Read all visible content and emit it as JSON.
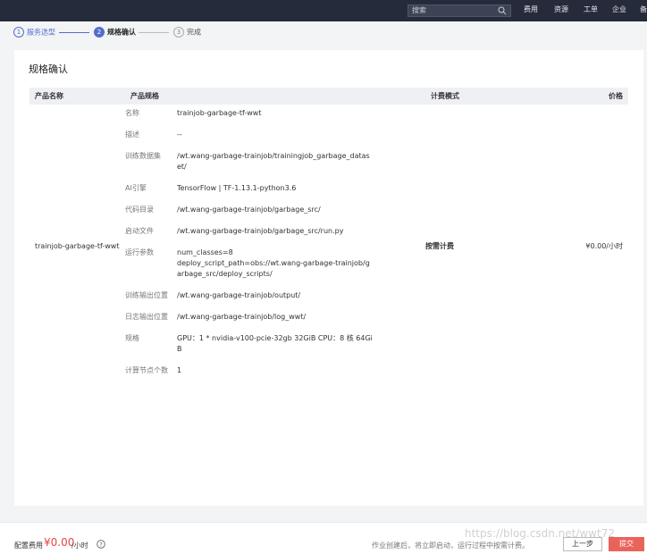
{
  "topbar": {
    "search_placeholder": "搜索",
    "nav": [
      "费用",
      "资源",
      "工单",
      "企业",
      "备"
    ]
  },
  "steps": [
    {
      "num": "1",
      "label": "服务选型",
      "state": "done"
    },
    {
      "num": "2",
      "label": "规格确认",
      "state": "active"
    },
    {
      "num": "3",
      "label": "完成",
      "state": "pending"
    }
  ],
  "panel": {
    "title": "规格确认",
    "headers": {
      "name": "产品名称",
      "spec": "产品规格",
      "mode": "计费模式",
      "price": "价格"
    },
    "row": {
      "name": "trainjob-garbage-tf-wwt",
      "mode": "按需计费",
      "price": "¥0.00/小时",
      "specs": [
        {
          "k": "名称",
          "v": "trainjob-garbage-tf-wwt"
        },
        {
          "k": "描述",
          "v": "--"
        },
        {
          "k": "训练数据集",
          "v": "/wt.wang-garbage-trainjob/trainingjob_garbage_dataset/"
        },
        {
          "k": "AI引擎",
          "v": "TensorFlow | TF-1.13.1-python3.6"
        },
        {
          "k": "代码目录",
          "v": "/wt.wang-garbage-trainjob/garbage_src/"
        },
        {
          "k": "启动文件",
          "v": "/wt.wang-garbage-trainjob/garbage_src/run.py"
        },
        {
          "k": "运行参数",
          "v": "num_classes=8\ndeploy_script_path=obs://wt.wang-garbage-trainjob/garbage_src/deploy_scripts/"
        },
        {
          "k": "训练输出位置",
          "v": "/wt.wang-garbage-trainjob/output/"
        },
        {
          "k": "日志输出位置",
          "v": "/wt.wang-garbage-trainjob/log_wwt/"
        },
        {
          "k": "规格",
          "v": "GPU：1 * nvidia-v100-pcie-32gb 32GiB CPU：8 核 64GiB"
        },
        {
          "k": "计算节点个数",
          "v": "1"
        }
      ]
    }
  },
  "footer": {
    "fee_label": "配置费用",
    "fee_amount": "¥0.00",
    "fee_unit": "/小时",
    "note": "作业创建后，将立即启动，运行过程中按需计费。",
    "prev_label": "上一步",
    "submit_label": "提交"
  },
  "watermark": "https://blog.csdn.net/wwt72",
  "colors": {
    "accent": "#526ecc",
    "price": "#e64545",
    "submit": "#e9635a",
    "topbar": "#252b3a"
  }
}
